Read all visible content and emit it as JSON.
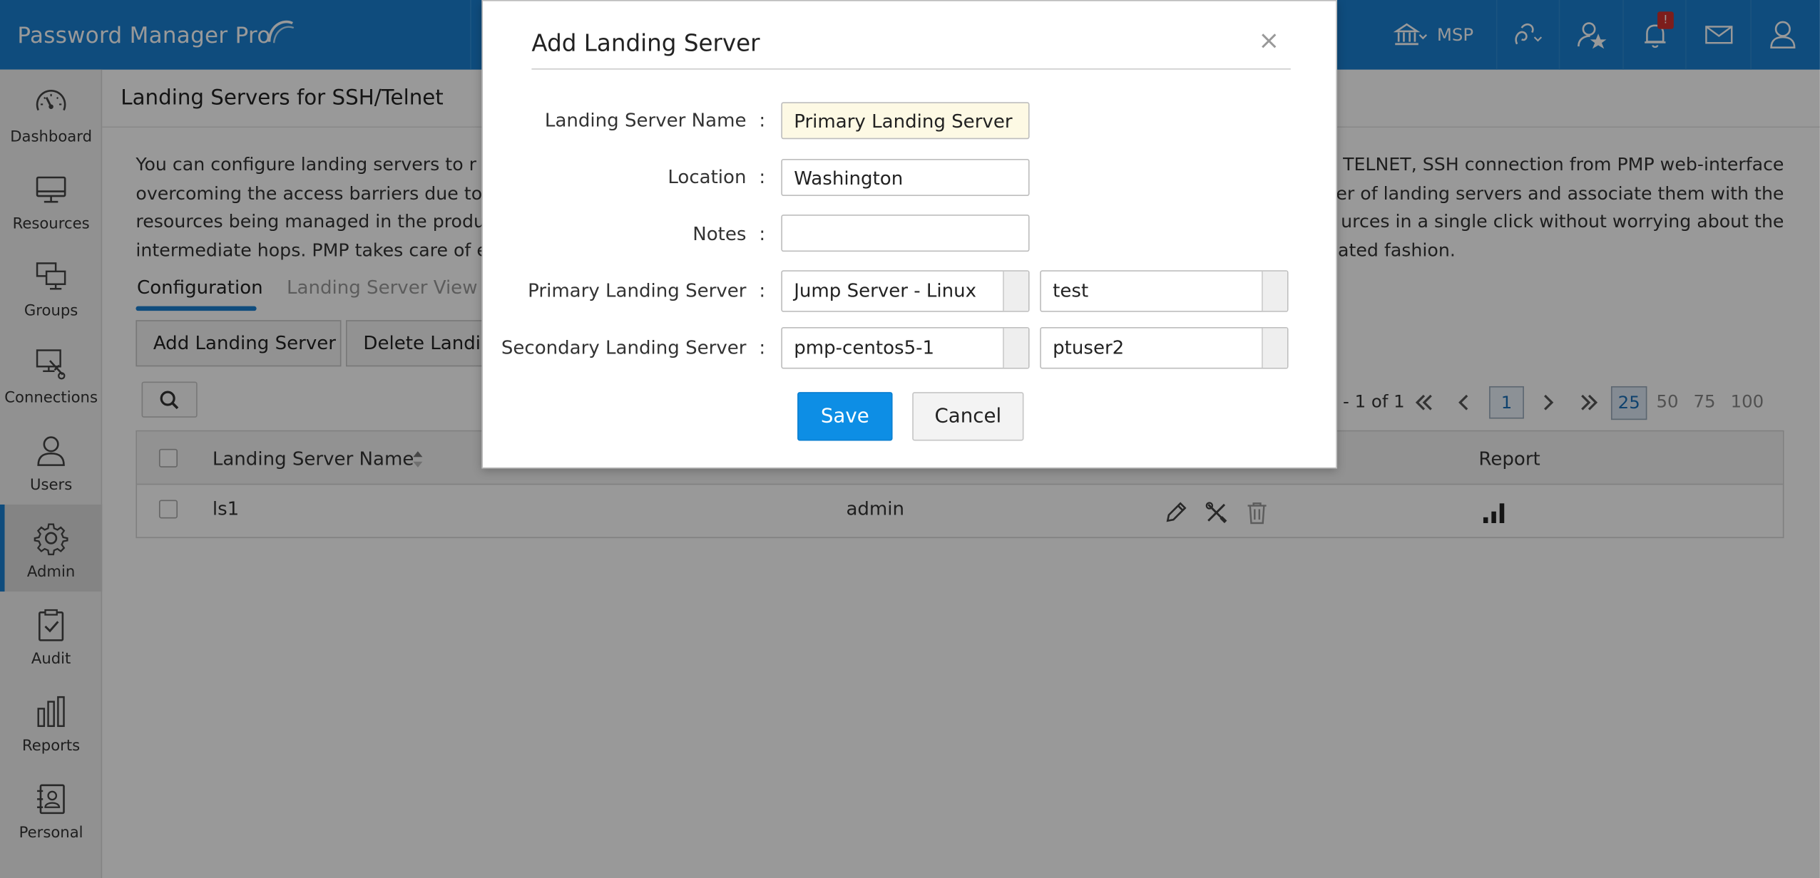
{
  "app": {
    "brand": "Password Manager Pro"
  },
  "topbar": {
    "msp_label": "MSP",
    "notification_count": "!"
  },
  "sidebar": {
    "items": [
      {
        "label": "Dashboard",
        "icon": "gauge-icon"
      },
      {
        "label": "Resources",
        "icon": "monitor-icon"
      },
      {
        "label": "Groups",
        "icon": "monitors-group-icon"
      },
      {
        "label": "Connections",
        "icon": "connection-icon"
      },
      {
        "label": "Users",
        "icon": "user-icon"
      },
      {
        "label": "Admin",
        "icon": "gear-icon",
        "active": true
      },
      {
        "label": "Audit",
        "icon": "clipboard-check-icon"
      },
      {
        "label": "Reports",
        "icon": "bar-chart-icon"
      },
      {
        "label": "Personal",
        "icon": "contact-book-icon"
      }
    ]
  },
  "main": {
    "title": "Landing Servers for SSH/Telnet",
    "description_left": [
      "You can configure landing servers to r",
      "overcoming the access barriers due to r",
      "resources being managed in the produ",
      "intermediate hops. PMP takes care of es"
    ],
    "description_right": [
      "TELNET, SSH connection from PMP web-interface",
      "ber of landing servers and associate them with the",
      "urces in a single click without worrying about the",
      "nated fashion."
    ],
    "tabs": [
      {
        "label": "Configuration",
        "active": true
      },
      {
        "label": "Landing Server View"
      }
    ],
    "buttons": {
      "add": "Add Landing Server",
      "delete": "Delete Landin"
    },
    "pager": {
      "range_text": "- 1 of 1",
      "page": "1",
      "page_sizes": [
        "25",
        "50",
        "75",
        "100"
      ],
      "selected_size": "25"
    },
    "table": {
      "headers": [
        "Landing Server Name",
        "Report"
      ],
      "rows": [
        {
          "name": "ls1",
          "owner": "admin"
        }
      ]
    }
  },
  "modal": {
    "title": "Add Landing Server",
    "close": "×",
    "fields": {
      "name": {
        "label": "Landing Server Name",
        "value": "Primary Landing Server"
      },
      "location": {
        "label": "Location",
        "value": "Washington"
      },
      "notes": {
        "label": "Notes",
        "value": ""
      },
      "primary": {
        "label": "Primary Landing Server",
        "server": "Jump Server - Linux",
        "account": "test"
      },
      "secondary": {
        "label": "Secondary Landing Server",
        "server": "pmp-centos5-1",
        "account": "ptuser2"
      }
    },
    "colon": ":",
    "save": "Save",
    "cancel": "Cancel"
  },
  "colors": {
    "topbar": "#1a7fd0",
    "save": "#0d8ee5",
    "name_field_bg": "#fdf9e4"
  }
}
